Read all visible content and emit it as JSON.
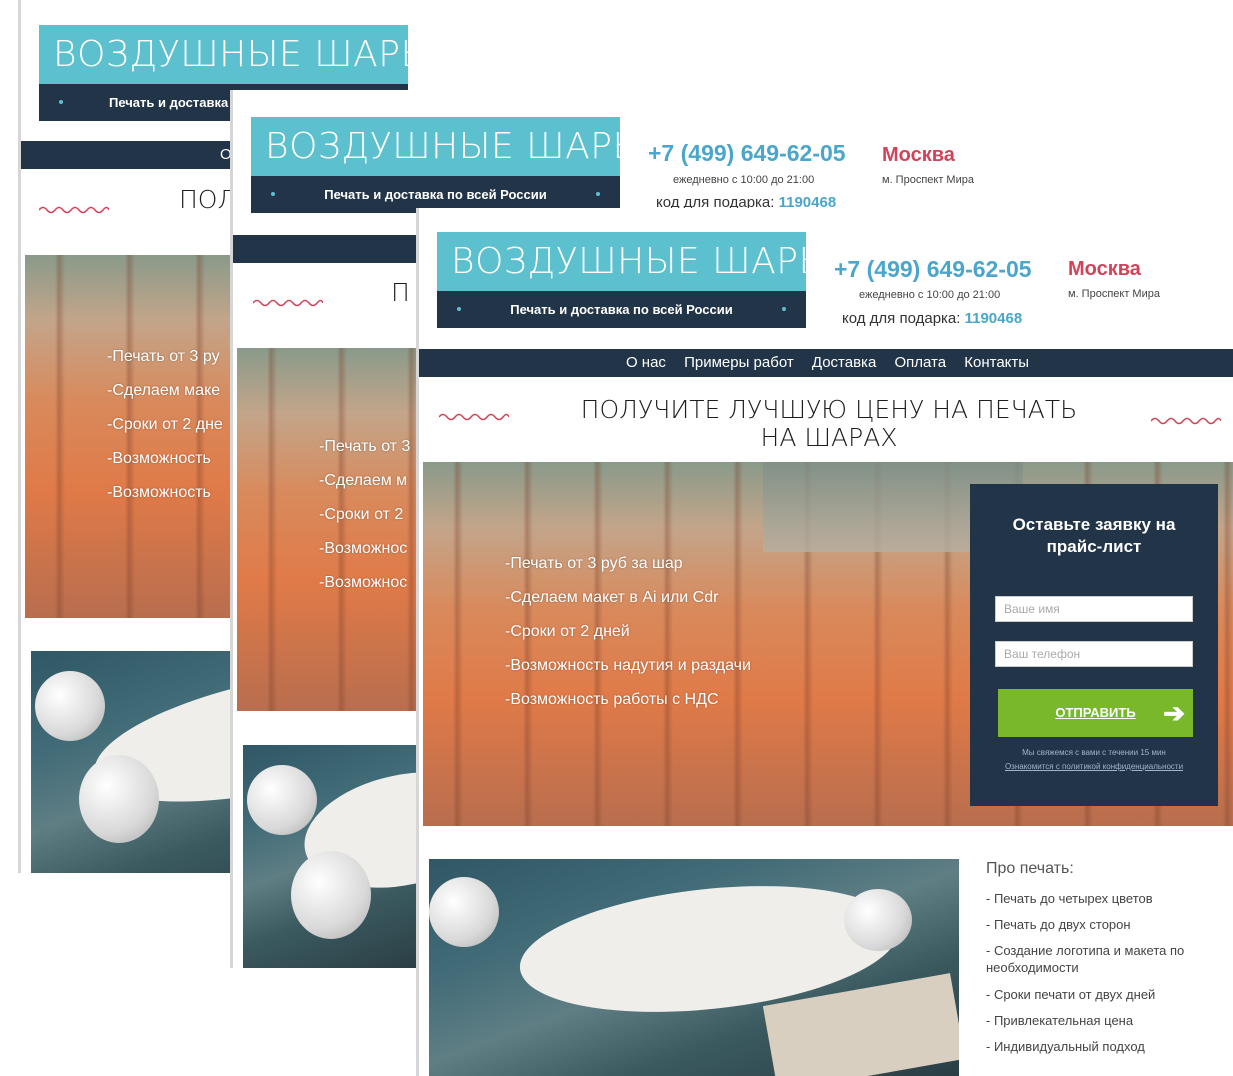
{
  "brand": {
    "title": "ВОЗДУШНЫЕ ШАРЫ",
    "tagline": "Печать и доставка по всей России",
    "tagline_cut_s1": "Печать и доставка по всей России",
    "colors": {
      "teal": "#5cc0cf",
      "navy": "#223548",
      "pink": "#d2435a",
      "green": "#7ab82b",
      "phone_blue": "#4aa6cc"
    }
  },
  "contact": {
    "phone": "+7 (499) 649-62-05",
    "hours": "ежедневно с 10:00 до 21:00",
    "gift_label": "код для подарка:",
    "gift_code": "1190468",
    "city": "Москва",
    "metro": "м. Проспект Мира"
  },
  "nav": {
    "items": [
      "О нас",
      "Примеры работ",
      "Доставка",
      "Оплата",
      "Контакты"
    ],
    "s1_fragment": "О"
  },
  "heading": {
    "text": "ПОЛУЧИТЕ ЛУЧШУЮ ЦЕНУ НА ПЕЧАТЬ НА ШАРАХ",
    "s1_fragment": "ПОЛ",
    "s2_fragment": "П"
  },
  "features": {
    "full": [
      "-Печать от 3 руб за шар",
      "-Сделаем макет в Ai или Cdr",
      "-Сроки от 2 дней",
      "-Возможность надутия и раздачи",
      "-Возможность работы с НДС"
    ],
    "s1": [
      "-Печать от 3 ру",
      "-Сделаем маке",
      "-Сроки от 2 дне",
      "-Возможность",
      "-Возможность"
    ],
    "s2": [
      "-Печать от 3",
      "-Сделаем м",
      "-Сроки от 2",
      "-Возможнос",
      "-Возможнос"
    ]
  },
  "form": {
    "title": "Оставьте заявку на прайс-лист",
    "name_placeholder": "Ваше имя",
    "phone_placeholder": "Ваш телефон",
    "submit": "ОТПРАВИТЬ",
    "note1": "Мы свяжемся с вами с течении 15 мин",
    "note2": "Ознакомится с политикой конфиденциальности"
  },
  "about": {
    "title": "Про печать:",
    "items": [
      "- Печать до четырех цветов",
      "- Печать до двух сторон",
      "- Создание логотипа и макета по необходимости",
      "- Сроки печати от двух дней",
      "- Привлекательная цена",
      "- Индивидуальный подход"
    ]
  },
  "icons": [
    "arrow-right-icon",
    "squiggle-decoration"
  ]
}
